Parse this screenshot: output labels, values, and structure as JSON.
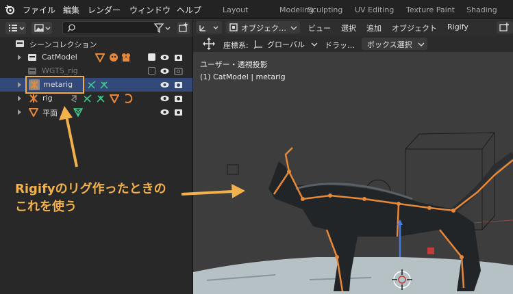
{
  "menubar": {
    "items": [
      "ファイル",
      "編集",
      "レンダー",
      "ウィンドウ",
      "ヘルプ"
    ],
    "workspaces": [
      "Layout",
      "Modeling",
      "Sculpting",
      "UV Editing",
      "Texture Paint",
      "Shading"
    ]
  },
  "outliner": {
    "root": "シーンコレクション",
    "rows": [
      {
        "label": "CatModel"
      },
      {
        "label": "WGTS_rig"
      },
      {
        "label": "metarig"
      },
      {
        "label": "rig"
      },
      {
        "label": "平面"
      }
    ]
  },
  "viewport": {
    "header": {
      "mode": "オブジェク…",
      "menus": [
        "ビュー",
        "選択",
        "追加",
        "オブジェクト",
        "Rigify"
      ]
    },
    "toolbar": {
      "coord_label": "座標系:",
      "coord_value": "グローバル",
      "drag_label": "ドラッ…",
      "select_mode": "ボックス選択"
    },
    "overlay": {
      "view_name": "ユーザー・透視投影",
      "object_info": "(1) CatModel | metarig"
    }
  },
  "annotation": {
    "line1": "Rigifyのリグ作ったときの",
    "line2": "これを使う",
    "color": "#f2b14c"
  },
  "colors": {
    "selection": "#33497a",
    "accent_orange": "#e8893a",
    "armature_green": "#3ec98a"
  }
}
